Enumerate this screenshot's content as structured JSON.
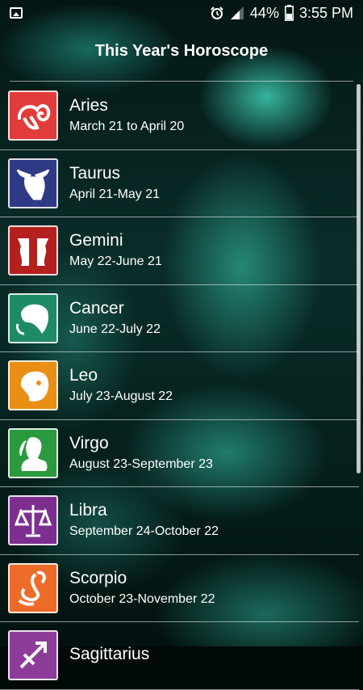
{
  "status_bar": {
    "battery": "44%",
    "time": "3:55 PM",
    "icons": [
      "gallery-icon",
      "alarm-icon",
      "signal-icon",
      "battery-icon"
    ]
  },
  "header": {
    "title": "This Year's Horoscope"
  },
  "signs": [
    {
      "name": "Aries",
      "dates": "March 21 to April 20",
      "color": "#e23b3b",
      "icon": "ram-icon"
    },
    {
      "name": "Taurus",
      "dates": "April 21-May 21",
      "color": "#2f3a87",
      "icon": "bull-icon"
    },
    {
      "name": "Gemini",
      "dates": "May 22-June 21",
      "color": "#b3201e",
      "icon": "twins-icon"
    },
    {
      "name": "Cancer",
      "dates": "June 22-July 22",
      "color": "#1f8a66",
      "icon": "crab-icon"
    },
    {
      "name": "Leo",
      "dates": "July 23-August 22",
      "color": "#e98f16",
      "icon": "lion-icon"
    },
    {
      "name": "Virgo",
      "dates": "August 23-September 23",
      "color": "#2b9a3e",
      "icon": "virgin-icon"
    },
    {
      "name": "Libra",
      "dates": "September 24-October 22",
      "color": "#7d2f8f",
      "icon": "scales-icon"
    },
    {
      "name": "Scorpio",
      "dates": "October 23-November 22",
      "color": "#ef6b2a",
      "icon": "scorpion-icon"
    },
    {
      "name": "Sagittarius",
      "dates": "",
      "color": "#8e3c9a",
      "icon": "archer-icon"
    }
  ]
}
